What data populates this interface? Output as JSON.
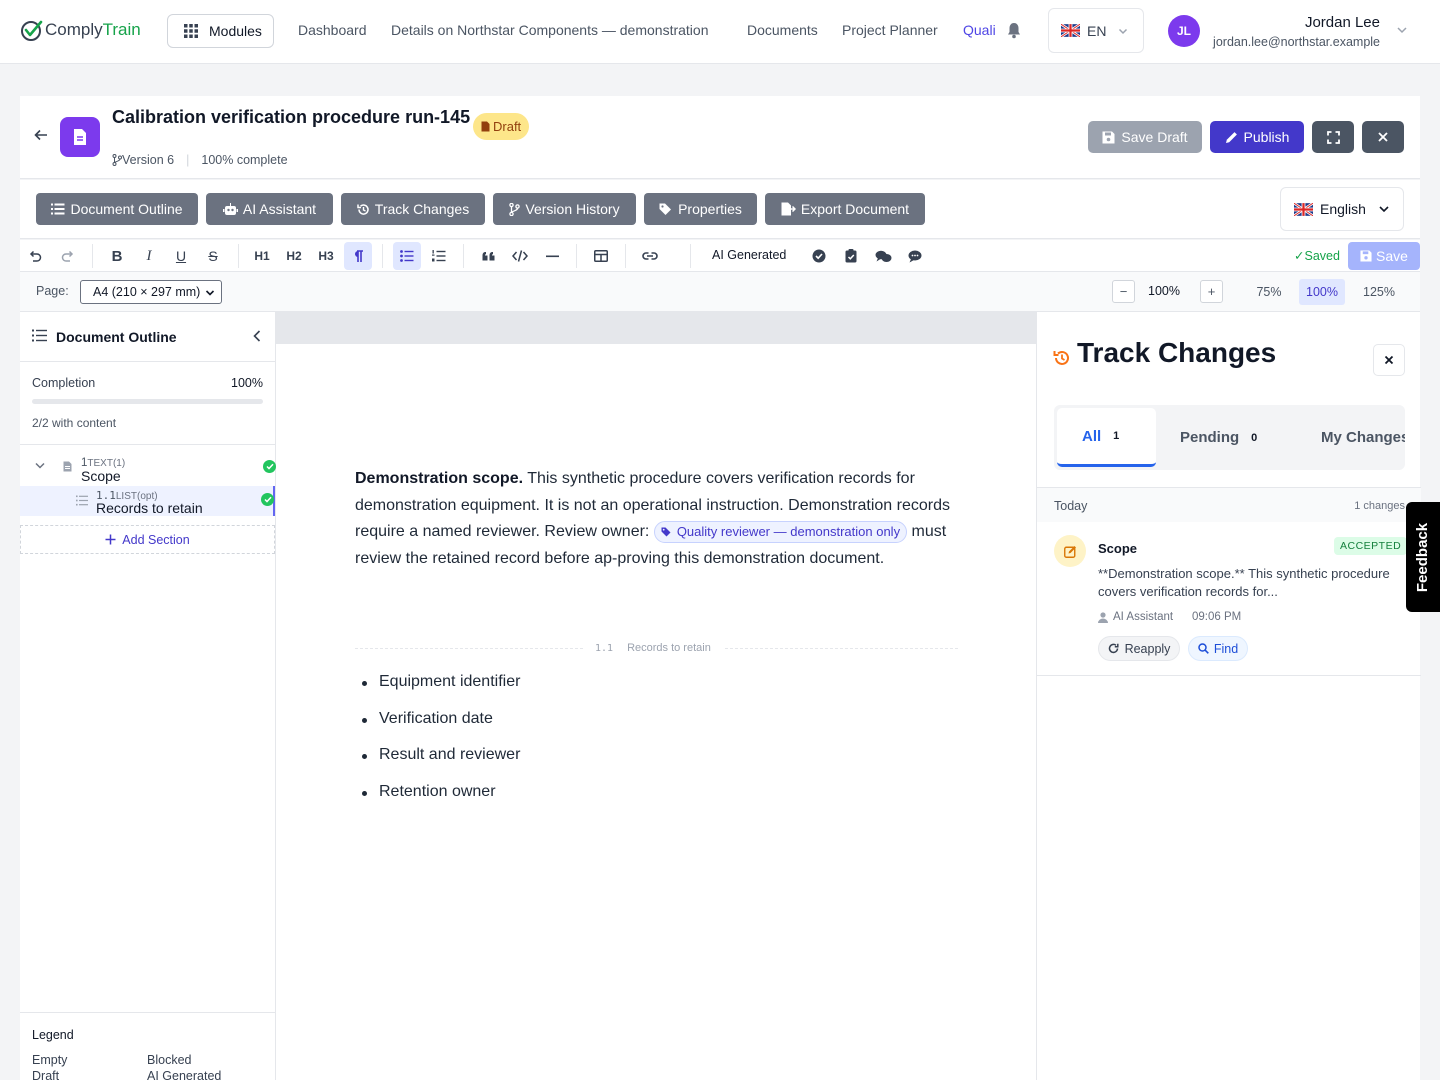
{
  "brand": {
    "name_part1": "Comply",
    "name_part2": "Train",
    "accent": "#16a34a"
  },
  "topnav": {
    "modules_label": "Modules",
    "links": [
      "Dashboard",
      "Details on Northstar Components — demonstration",
      "Documents",
      "Project Planner",
      "Quali"
    ],
    "active_link": "Quali",
    "language": "EN",
    "user": {
      "initials": "JL",
      "name": "Jordan Lee",
      "email": "jordan.lee@northstar.example"
    }
  },
  "document": {
    "title": "Calibration verification procedure run-145",
    "status": "Draft",
    "version": "Version 6",
    "progress": "100% complete",
    "buttons": {
      "save_draft": "Save Draft",
      "publish": "Publish"
    }
  },
  "action_bar": {
    "buttons": [
      "Document Outline",
      "AI Assistant",
      "Track Changes",
      "Version History",
      "Properties",
      "Export Document"
    ],
    "language": "English"
  },
  "format_toolbar": {
    "headings": [
      "H1",
      "H2",
      "H3"
    ],
    "ai_generated_label": "AI Generated",
    "saved_label": "Saved",
    "save_label": "Save"
  },
  "page_bar": {
    "page_label": "Page:",
    "page_size": "A4 (210 × 297 mm)",
    "zoom_value": "100%",
    "zoom_presets": [
      "75%",
      "100%",
      "125%"
    ],
    "active_preset": "100%"
  },
  "outline": {
    "title": "Document Outline",
    "completion_label": "Completion",
    "completion_value": "100%",
    "completion_fraction": 1.0,
    "content_count": "2/2 with content",
    "items": [
      {
        "number": "1",
        "type": "TEXT(1)",
        "name": "Scope",
        "complete": true
      },
      {
        "number": "1.1",
        "type": "LIST(opt)",
        "name": "Records to retain",
        "complete": true
      }
    ],
    "add_section_label": "Add Section",
    "legend": {
      "title": "Legend",
      "entries": [
        "Empty",
        "Blocked",
        "Draft",
        "AI Generated"
      ]
    }
  },
  "editor": {
    "intro_bold": "Demonstration scope.",
    "intro_text": " This synthetic procedure covers verification records for demonstration equipment. It is not an operational instruction. Demonstration records require a named reviewer. Review owner:",
    "chip_label": "Quality reviewer — demonstration only",
    "after_chip": " must review the retained record before ap-proving this demonstration document.",
    "section_number": "1.1",
    "section_title": "Records to retain",
    "list_items": [
      "Equipment identifier",
      "Verification date",
      "Result and reviewer",
      "Retention owner"
    ]
  },
  "track_changes": {
    "title": "Track Changes",
    "tabs": [
      {
        "label": "All",
        "count": "1"
      },
      {
        "label": "Pending",
        "count": "0"
      },
      {
        "label": "My Changes",
        "count": ""
      }
    ],
    "active_tab": "All",
    "group_label": "Today",
    "group_count": "1 changes",
    "change": {
      "section": "Scope",
      "status": "ACCEPTED",
      "text": "**Demonstration scope.** This synthetic procedure covers verification records for...",
      "author": "AI Assistant",
      "time": "09:06 PM",
      "reapply_label": "Reapply",
      "find_label": "Find"
    }
  },
  "feedback_label": "Feedback"
}
